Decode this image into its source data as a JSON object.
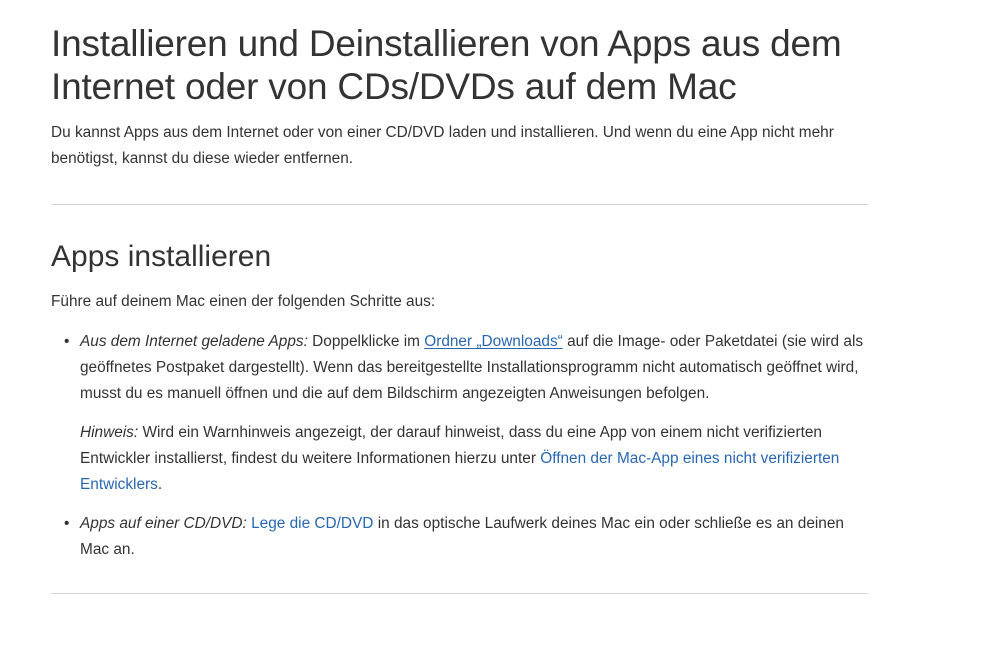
{
  "article": {
    "title": "Installieren und Deinstallieren von Apps aus dem Internet oder von CDs/DVDs auf dem Mac",
    "intro": "Du kannst Apps aus dem Internet oder von einer CD/DVD laden und installieren. Und wenn du eine App nicht mehr benötigst, kannst du diese wieder entfernen."
  },
  "section": {
    "title": "Apps installieren",
    "lead": "Führe auf deinem Mac einen der folgenden Schritte aus:",
    "items": [
      {
        "bullet": "•",
        "label": "Aus dem Internet geladene Apps:",
        "text_before_link": " Doppelklicke im ",
        "link": "Ordner „Downloads“",
        "text_after_link": " auf die Image- oder Paketdatei (sie wird als geöffnetes Postpaket dargestellt). Wenn das bereitgestellte Installationsprogramm nicht automatisch geöffnet wird, musst du es manuell öffnen und die auf dem Bildschirm angezeigten Anweisungen befolgen.",
        "note": {
          "label": "Hinweis:",
          "text_before_link": " Wird ein Warnhinweis angezeigt, der darauf hinweist, dass du eine App von einem nicht verifizierten Entwickler installierst, findest du weitere Informationen hierzu unter ",
          "link": "Öffnen der Mac-App eines nicht verifizierten Entwicklers",
          "text_after_link": "."
        }
      },
      {
        "bullet": "•",
        "label": "Apps auf einer CD/DVD:",
        "text_before_link": " ",
        "link": "Lege die CD/DVD",
        "text_after_link": " in das optische Laufwerk deines Mac ein oder schließe es an deinen Mac an."
      }
    ]
  },
  "colors": {
    "text": "#333333",
    "link": "#2867b2",
    "divider": "#d2d2d7",
    "background": "#ffffff"
  }
}
